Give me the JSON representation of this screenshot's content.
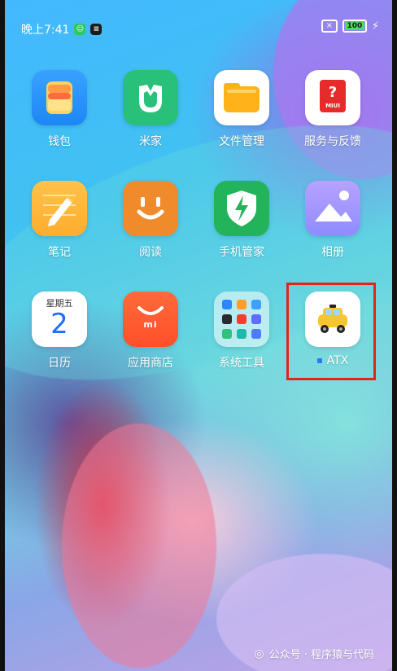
{
  "status": {
    "time": "晚上7:41",
    "battery": "100"
  },
  "apps": [
    {
      "label": "钱包"
    },
    {
      "label": "米家"
    },
    {
      "label": "文件管理"
    },
    {
      "label": "服务与反馈",
      "badge": "MIUI"
    },
    {
      "label": "笔记"
    },
    {
      "label": "阅读"
    },
    {
      "label": "手机管家"
    },
    {
      "label": "相册"
    },
    {
      "label": "日历",
      "weekday": "星期五",
      "day": "2"
    },
    {
      "label": "应用商店",
      "brand": "mi"
    },
    {
      "label": "系统工具"
    },
    {
      "label": "ATX"
    }
  ],
  "watermark": {
    "text": "公众号 · 程序猿与代码"
  },
  "colors": {
    "highlight": "#e1251b",
    "wallpaper_blue": "#43b8ff",
    "wallpaper_teal": "#6ed7df",
    "wallpaper_violet": "#c2a1e5"
  },
  "icons": [
    "wallet-icon",
    "mijia-icon",
    "folder-icon",
    "feedback-icon",
    "notes-icon",
    "reader-icon",
    "security-icon",
    "gallery-icon",
    "calendar-icon",
    "app-store-icon",
    "system-tools-icon",
    "atx-car-icon"
  ]
}
